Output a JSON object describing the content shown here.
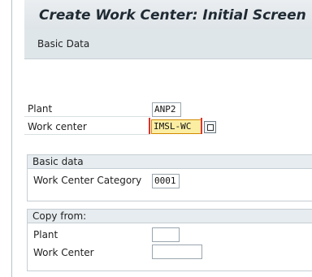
{
  "title": "Create Work Center: Initial Screen",
  "toolbar": {
    "basic_data": "Basic Data"
  },
  "fields": {
    "plant_label": "Plant",
    "plant_value": "ANP2",
    "work_center_label": "Work center",
    "work_center_value": "IMSL-WC"
  },
  "basic_data_group": {
    "header": "Basic data",
    "category_label": "Work Center Category",
    "category_value": "0001"
  },
  "copy_from_group": {
    "header": "Copy from:",
    "plant_label": "Plant",
    "plant_value": "",
    "work_center_label": "Work Center",
    "work_center_value": ""
  },
  "icons": {
    "lookup": "possible-entries-icon"
  },
  "colors": {
    "required_highlight": "#fbeea3",
    "required_mark": "#dd3333"
  }
}
